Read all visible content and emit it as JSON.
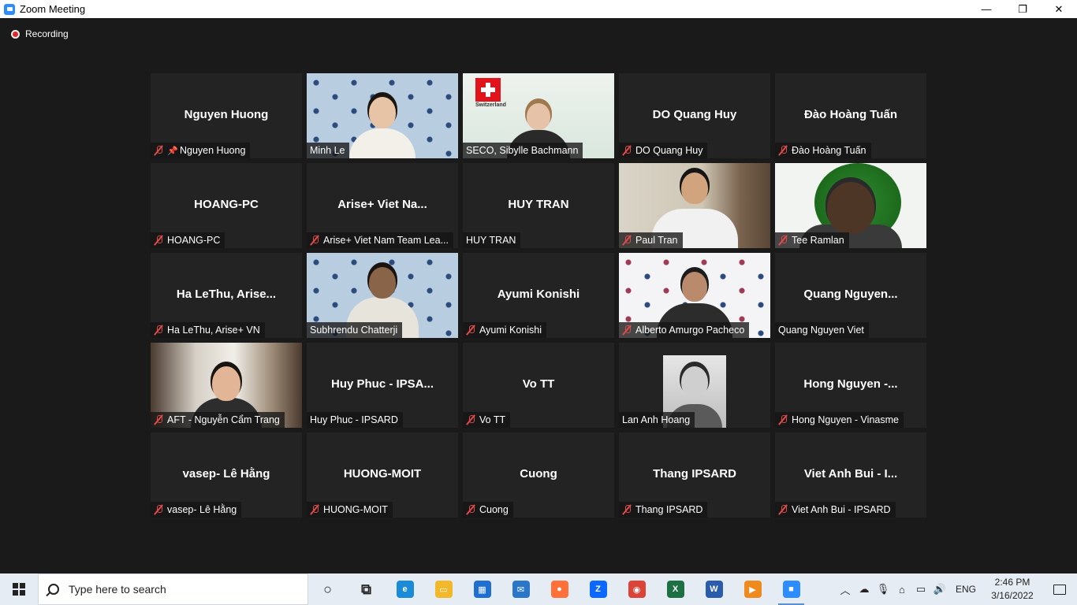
{
  "window": {
    "title": "Zoom Meeting",
    "minimize": "—",
    "maximize": "❐",
    "close": "✕"
  },
  "meeting": {
    "recording_label": "Recording"
  },
  "tiles": [
    {
      "big": "Nguyen Huong",
      "label": "Nguyen Huong",
      "muted": true,
      "pinned": true,
      "video": ""
    },
    {
      "big": "",
      "label": "Minh Le",
      "muted": false,
      "video": "itc-woman"
    },
    {
      "big": "",
      "label": "SECO, Sibylle Bachmann",
      "muted": false,
      "video": "swiss",
      "active": true
    },
    {
      "big": "DO Quang Huy",
      "label": "DO Quang Huy",
      "muted": true,
      "video": ""
    },
    {
      "big": "Đào Hoàng Tuấn",
      "label": "Đào Hoàng Tuấn",
      "muted": true,
      "video": ""
    },
    {
      "big": "HOANG-PC",
      "label": "HOANG-PC",
      "muted": true,
      "video": ""
    },
    {
      "big": "Arise+ Viet Na...",
      "label": "Arise+ Viet Nam Team Lea...",
      "muted": true,
      "video": ""
    },
    {
      "big": "HUY TRAN",
      "label": "HUY TRAN",
      "muted": false,
      "video": ""
    },
    {
      "big": "",
      "label": "Paul Tran",
      "muted": true,
      "video": "office"
    },
    {
      "big": "",
      "label": "Tee Ramlan",
      "muted": true,
      "video": "green"
    },
    {
      "big": "Ha LeThu, Arise...",
      "label": "Ha LeThu, Arise+ VN",
      "muted": true,
      "video": ""
    },
    {
      "big": "",
      "label": "Subhrendu Chatterji",
      "muted": false,
      "video": "itc-man"
    },
    {
      "big": "Ayumi Konishi",
      "label": "Ayumi Konishi",
      "muted": true,
      "video": ""
    },
    {
      "big": "",
      "label": "Alberto Amurgo Pacheco",
      "muted": true,
      "video": "itc-light"
    },
    {
      "big": "Quang  Nguyen...",
      "label": "Quang Nguyen Viet",
      "muted": false,
      "video": ""
    },
    {
      "big": "",
      "label": "AFT - Nguyễn Cẩm Trang",
      "muted": true,
      "video": "hotel"
    },
    {
      "big": "Huy Phuc - IPSA...",
      "label": "Huy Phuc - IPSARD",
      "muted": false,
      "video": ""
    },
    {
      "big": "Vo TT",
      "label": "Vo TT",
      "muted": true,
      "video": ""
    },
    {
      "big": "",
      "label": "Lan Anh Hoang",
      "muted": false,
      "video": "bw"
    },
    {
      "big": "Hong  Nguyen -...",
      "label": "Hong Nguyen - Vinasme",
      "muted": true,
      "video": ""
    },
    {
      "big": "vasep- Lê Hằng",
      "label": "vasep- Lê Hằng",
      "muted": true,
      "video": ""
    },
    {
      "big": "HUONG-MOIT",
      "label": "HUONG-MOIT",
      "muted": true,
      "video": ""
    },
    {
      "big": "Cuong",
      "label": "Cuong",
      "muted": true,
      "video": ""
    },
    {
      "big": "Thang IPSARD",
      "label": "Thang IPSARD",
      "muted": true,
      "video": ""
    },
    {
      "big": "Viet Anh Bui - I...",
      "label": "Viet Anh Bui - IPSARD",
      "muted": true,
      "video": ""
    }
  ],
  "swiss_word": "Switzerland",
  "taskbar": {
    "search_placeholder": "Type here to search",
    "apps": [
      {
        "name": "cortana-icon",
        "glyph": "○",
        "color": "transparent",
        "fg": "#222"
      },
      {
        "name": "task-view-icon",
        "glyph": "⧉",
        "color": "transparent",
        "fg": "#222"
      },
      {
        "name": "edge-icon",
        "glyph": "e",
        "color": "#1b8ad8",
        "fg": "#fff"
      },
      {
        "name": "file-explorer-icon",
        "glyph": "▭",
        "color": "#f3b829",
        "fg": "#fff"
      },
      {
        "name": "store-icon",
        "glyph": "▦",
        "color": "#1f6fd0",
        "fg": "#fff"
      },
      {
        "name": "mail-icon",
        "glyph": "✉",
        "color": "#2a77c8",
        "fg": "#fff"
      },
      {
        "name": "firefox-icon",
        "glyph": "●",
        "color": "#ff7139",
        "fg": "#fff"
      },
      {
        "name": "zalo-icon",
        "glyph": "Z",
        "color": "#0a68ff",
        "fg": "#fff"
      },
      {
        "name": "chrome-icon",
        "glyph": "◉",
        "color": "#db4437",
        "fg": "#fff"
      },
      {
        "name": "excel-icon",
        "glyph": "X",
        "color": "#1d7044",
        "fg": "#fff"
      },
      {
        "name": "word-icon",
        "glyph": "W",
        "color": "#2b5cab",
        "fg": "#fff"
      },
      {
        "name": "media-player-icon",
        "glyph": "▶",
        "color": "#f08a1c",
        "fg": "#fff"
      },
      {
        "name": "zoom-icon",
        "glyph": "■",
        "color": "#2D8CFF",
        "fg": "#fff"
      }
    ],
    "lang": "ENG",
    "time": "2:46 PM",
    "date": "3/16/2022"
  }
}
